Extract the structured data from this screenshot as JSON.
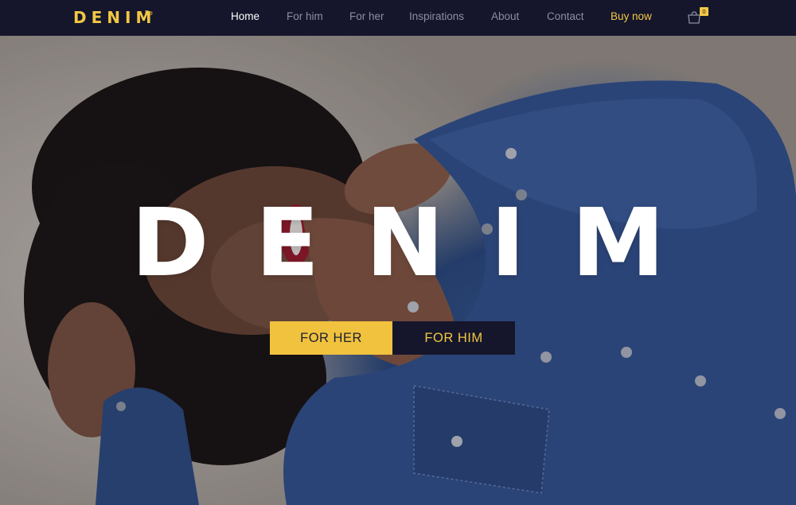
{
  "brand": {
    "logo_text": "DENIM",
    "logo_superscript": "Be",
    "accent_color": "#f2c744",
    "nav_bg": "#15162b"
  },
  "nav": {
    "links": [
      {
        "label": "Home",
        "active": true
      },
      {
        "label": "For him",
        "active": false
      },
      {
        "label": "For her",
        "active": false
      },
      {
        "label": "Inspirations",
        "active": false
      },
      {
        "label": "About",
        "active": false
      },
      {
        "label": "Contact",
        "active": false
      }
    ],
    "buy_now_label": "Buy now",
    "cart": {
      "icon": "shopping-bag-icon",
      "count": "0"
    }
  },
  "hero": {
    "title": "DENIM",
    "image_description_icon": "hero-photo",
    "buttons": {
      "for_her_label": "FOR HER",
      "for_him_label": "FOR HIM"
    }
  }
}
